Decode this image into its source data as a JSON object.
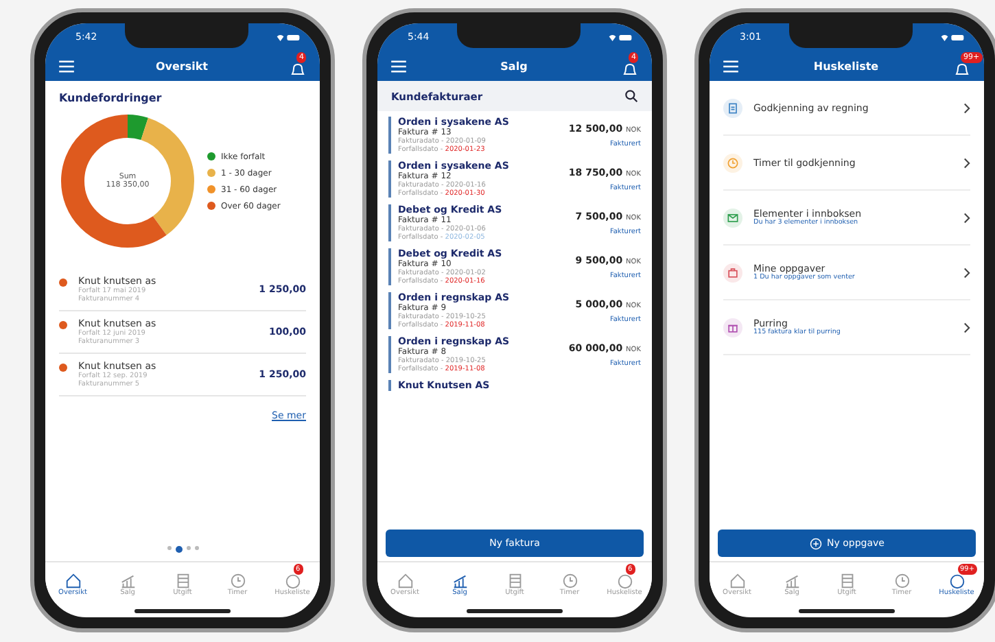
{
  "phones": [
    {
      "kind": "overview",
      "time": "5:42",
      "title": "Oversikt",
      "bell_badge": "4",
      "card_title": "Kundefordringer",
      "sum_label": "Sum",
      "sum_value": "118 350,00",
      "legend": [
        {
          "label": "Ikke forfalt",
          "color": "#1e9a2e"
        },
        {
          "label": "1 - 30 dager",
          "color": "#e8b24a"
        },
        {
          "label": "31 - 60 dager",
          "color": "#f0922a"
        },
        {
          "label": "Over 60 dager",
          "color": "#de5a1e"
        }
      ],
      "items": [
        {
          "name": "Knut knutsen as",
          "due": "Forfalt 17 mai 2019",
          "number": "Fakturanummer 4",
          "amount": "1 250,00"
        },
        {
          "name": "Knut knutsen as",
          "due": "Forfalt 12 juni 2019",
          "number": "Fakturanummer 3",
          "amount": "100,00"
        },
        {
          "name": "Knut knutsen as",
          "due": "Forfalt 12 sep. 2019",
          "number": "Fakturanummer 5",
          "amount": "1 250,00"
        }
      ],
      "more_link": "Se mer",
      "pages": [
        {
          "selected": false
        },
        {
          "selected": true
        },
        {
          "selected": false
        },
        {
          "selected": false
        }
      ],
      "tabs": [
        {
          "label": "Oversikt",
          "selected": true
        },
        {
          "label": "Salg",
          "selected": false
        },
        {
          "label": "Utgift",
          "selected": false
        },
        {
          "label": "Timer",
          "selected": false
        },
        {
          "label": "Huskeliste",
          "selected": false,
          "badge": "6"
        }
      ]
    },
    {
      "kind": "sales",
      "time": "5:44",
      "title": "Salg",
      "bell_badge": "4",
      "search_title": "Kundefakturaer",
      "invoices": [
        {
          "customer": "Orden i sysakene AS",
          "invoice": "Faktura # 13",
          "date": "Fakturadato - 2020-01-09",
          "due_label": "Forfallsdato - ",
          "due": "2020-01-23",
          "overdue": true,
          "amount": "12 500,00",
          "currency": "NOK",
          "status": "Fakturert"
        },
        {
          "customer": "Orden i sysakene AS",
          "invoice": "Faktura # 12",
          "date": "Fakturadato - 2020-01-16",
          "due_label": "Forfallsdato - ",
          "due": "2020-01-30",
          "overdue": true,
          "amount": "18 750,00",
          "currency": "NOK",
          "status": "Fakturert"
        },
        {
          "customer": "Debet og Kredit AS",
          "invoice": "Faktura # 11",
          "date": "Fakturadato - 2020-01-06",
          "due_label": "Forfallsdato - ",
          "due": "2020-02-05",
          "overdue": false,
          "amount": "7 500,00",
          "currency": "NOK",
          "status": "Fakturert"
        },
        {
          "customer": "Debet og Kredit AS",
          "invoice": "Faktura # 10",
          "date": "Fakturadato - 2020-01-02",
          "due_label": "Forfallsdato - ",
          "due": "2020-01-16",
          "overdue": true,
          "amount": "9 500,00",
          "currency": "NOK",
          "status": "Fakturert"
        },
        {
          "customer": "Orden i regnskap AS",
          "invoice": "Faktura # 9",
          "date": "Fakturadato - 2019-10-25",
          "due_label": "Forfallsdato - ",
          "due": "2019-11-08",
          "overdue": true,
          "amount": "5 000,00",
          "currency": "NOK",
          "status": "Fakturert"
        },
        {
          "customer": "Orden i regnskap AS",
          "invoice": "Faktura # 8",
          "date": "Fakturadato - 2019-10-25",
          "due_label": "Forfallsdato - ",
          "due": "2019-11-08",
          "overdue": true,
          "amount": "60 000,00",
          "currency": "NOK",
          "status": "Fakturert"
        },
        {
          "customer": "Knut Knutsen AS"
        }
      ],
      "button": "Ny faktura",
      "tabs": [
        {
          "label": "Oversikt",
          "selected": false
        },
        {
          "label": "Salg",
          "selected": true
        },
        {
          "label": "Utgift",
          "selected": false
        },
        {
          "label": "Timer",
          "selected": false
        },
        {
          "label": "Huskeliste",
          "selected": false,
          "badge": "6"
        }
      ]
    },
    {
      "kind": "todo",
      "time": "3:01",
      "title": "Huskeliste",
      "bell_badge": "99+",
      "tasks": [
        {
          "kind": "bill",
          "title": "Godkjenning av regning",
          "color": "#3b82c4"
        },
        {
          "kind": "hours",
          "title": "Timer til godkjenning",
          "color": "#f0a030"
        },
        {
          "kind": "inbox",
          "title": "Elementer i innboksen",
          "subtitle": "Du har 3 elementer i innboksen",
          "color": "#2e9e4e"
        },
        {
          "kind": "tasks",
          "title": "Mine oppgaver",
          "subtitle": "1 Du har oppgaver som venter",
          "color": "#d8505a"
        },
        {
          "kind": "reminder",
          "title": "Purring",
          "subtitle": "115 faktura klar til purring",
          "color": "#b04fb0"
        }
      ],
      "button": "Ny oppgave",
      "tabs": [
        {
          "label": "Oversikt",
          "selected": false
        },
        {
          "label": "Salg",
          "selected": false
        },
        {
          "label": "Utgift",
          "selected": false
        },
        {
          "label": "Timer",
          "selected": false
        },
        {
          "label": "Huskeliste",
          "selected": true,
          "badge": "99+"
        }
      ]
    }
  ]
}
